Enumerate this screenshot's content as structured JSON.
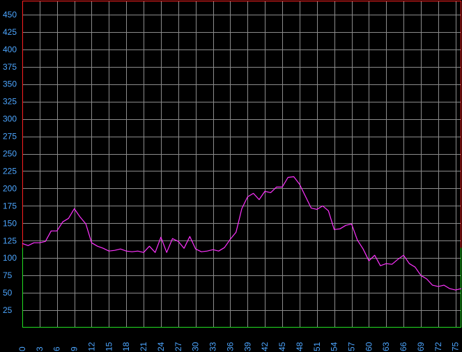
{
  "chart_data": {
    "type": "line",
    "title": "",
    "xlabel": "",
    "ylabel": "",
    "xlim": [
      0,
      76
    ],
    "ylim": [
      0,
      470
    ],
    "x_ticks": [
      0,
      3,
      6,
      9,
      12,
      15,
      18,
      21,
      24,
      27,
      30,
      33,
      36,
      39,
      42,
      45,
      48,
      51,
      54,
      57,
      60,
      63,
      66,
      69,
      72,
      75
    ],
    "y_ticks": [
      25,
      50,
      75,
      100,
      125,
      150,
      175,
      200,
      225,
      250,
      275,
      300,
      325,
      350,
      375,
      400,
      425,
      450
    ],
    "grid": true,
    "legend": "none",
    "colors": {
      "background": "#000000",
      "grid": "#8c8c8c",
      "tick_label": "#4da6ff",
      "line": "#ff33ff",
      "frame_upper": "#ff2020",
      "frame_lower": "#22e022"
    },
    "frame_split_value": 115,
    "series": [
      {
        "values": [
          [
            0,
            121
          ],
          [
            1,
            118
          ],
          [
            2,
            122
          ],
          [
            3,
            122
          ],
          [
            4,
            124
          ],
          [
            5,
            139
          ],
          [
            6,
            139
          ],
          [
            7,
            152
          ],
          [
            8,
            157
          ],
          [
            9,
            171
          ],
          [
            10,
            159
          ],
          [
            11,
            149
          ],
          [
            12,
            122
          ],
          [
            13,
            117
          ],
          [
            14,
            114
          ],
          [
            15,
            110
          ],
          [
            16,
            111
          ],
          [
            17,
            113
          ],
          [
            18,
            110
          ],
          [
            19,
            109
          ],
          [
            20,
            110
          ],
          [
            21,
            108
          ],
          [
            22,
            117
          ],
          [
            23,
            108
          ],
          [
            24,
            130
          ],
          [
            25,
            108
          ],
          [
            26,
            128
          ],
          [
            27,
            124
          ],
          [
            28,
            114
          ],
          [
            29,
            131
          ],
          [
            30,
            113
          ],
          [
            31,
            109
          ],
          [
            32,
            110
          ],
          [
            33,
            112
          ],
          [
            34,
            110
          ],
          [
            35,
            115
          ],
          [
            36,
            127
          ],
          [
            37,
            137
          ],
          [
            38,
            171
          ],
          [
            39,
            188
          ],
          [
            40,
            193
          ],
          [
            41,
            184
          ],
          [
            42,
            196
          ],
          [
            43,
            194
          ],
          [
            44,
            202
          ],
          [
            45,
            202
          ],
          [
            46,
            216
          ],
          [
            47,
            217
          ],
          [
            48,
            206
          ],
          [
            49,
            189
          ],
          [
            50,
            172
          ],
          [
            51,
            170
          ],
          [
            52,
            175
          ],
          [
            53,
            168
          ],
          [
            54,
            141
          ],
          [
            55,
            142
          ],
          [
            56,
            147
          ],
          [
            57,
            149
          ],
          [
            58,
            126
          ],
          [
            59,
            113
          ],
          [
            60,
            96
          ],
          [
            61,
            104
          ],
          [
            62,
            89
          ],
          [
            63,
            92
          ],
          [
            64,
            91
          ],
          [
            65,
            98
          ],
          [
            66,
            104
          ],
          [
            67,
            92
          ],
          [
            68,
            87
          ],
          [
            69,
            75
          ],
          [
            70,
            70
          ],
          [
            71,
            61
          ],
          [
            72,
            59
          ],
          [
            73,
            61
          ],
          [
            74,
            56
          ],
          [
            75,
            54
          ],
          [
            76,
            56
          ]
        ]
      }
    ]
  }
}
